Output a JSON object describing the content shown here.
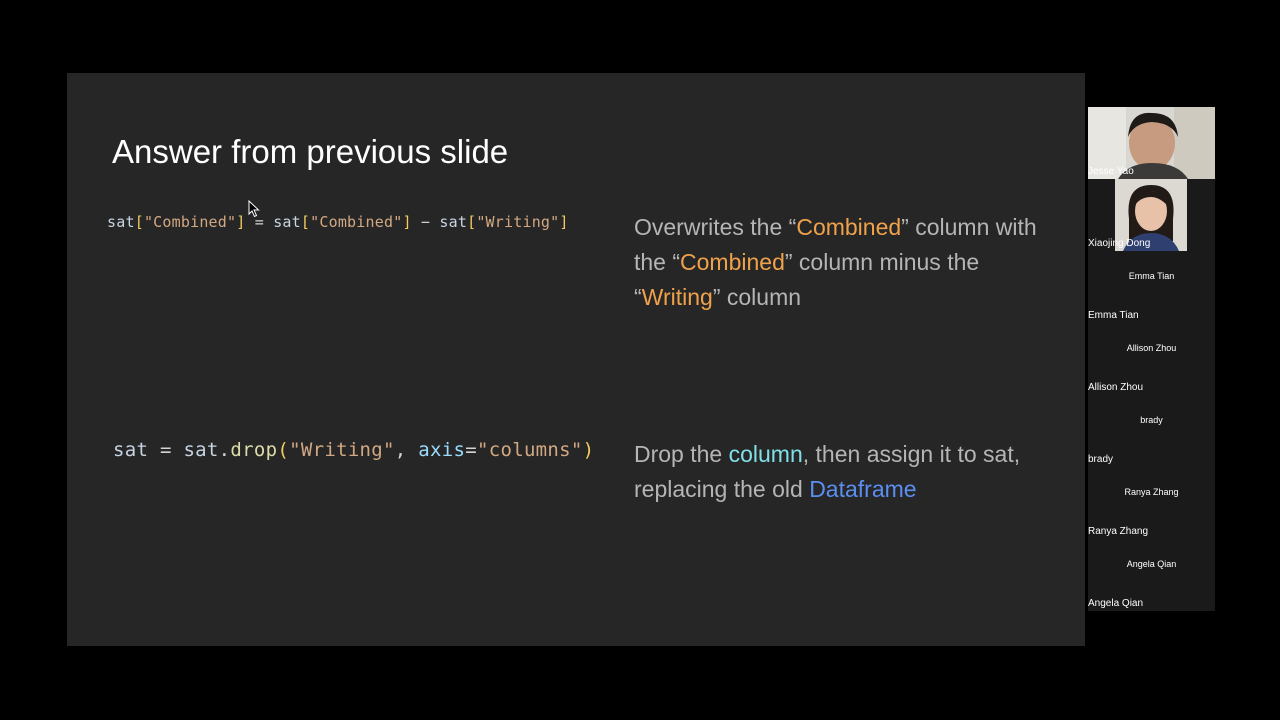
{
  "slide": {
    "title": "Answer from previous slide",
    "example1": {
      "code": {
        "t1": "sat",
        "t2": "[",
        "t3": "\"Combined\"",
        "t4": "]",
        "t5": " = ",
        "t6": "sat",
        "t7": "[",
        "t8": "\"Combined\"",
        "t9": "]",
        "t10": " − ",
        "t11": "sat",
        "t12": "[",
        "t13": "\"Writing\"",
        "t14": "]"
      },
      "description": {
        "p1": "Overwrites the “",
        "h1": "Combined",
        "p2": "” column with the “",
        "h2": "Combined",
        "p3": "” column minus the “",
        "h3": "Writing",
        "p4": "” column"
      }
    },
    "example2": {
      "code": {
        "t1": "sat",
        "t2": " = ",
        "t3": "sat",
        "t4": ".",
        "t5": "drop",
        "t6": "(",
        "t7": "\"Writing\"",
        "t8": ", ",
        "t9": "axis",
        "t10": "=",
        "t11": "\"columns\"",
        "t12": ")"
      },
      "description": {
        "p1": "Drop the ",
        "h1": "column",
        "p2": ", then assign it to sat, replacing the old ",
        "h2": "Dataframe"
      }
    }
  },
  "participants": [
    {
      "name": "Jesse Yao",
      "video": true
    },
    {
      "name": "Xiaojing Dong",
      "video": true
    },
    {
      "name": "Emma Tian",
      "center_name": "Emma Tian",
      "video": false
    },
    {
      "name": "Allison Zhou",
      "center_name": "Allison Zhou",
      "video": false
    },
    {
      "name": "brady",
      "center_name": "brady",
      "video": false
    },
    {
      "name": "Ranya Zhang",
      "center_name": "Ranya Zhang",
      "video": false
    },
    {
      "name": "Angela Qian",
      "center_name": "Angela Qian",
      "video": false
    }
  ],
  "colors": {
    "background": "#000000",
    "slide_bg": "#262626",
    "highlight_orange": "#f0a24a",
    "highlight_cyan": "#7fe0e8",
    "highlight_blue": "#5b8ef0"
  }
}
